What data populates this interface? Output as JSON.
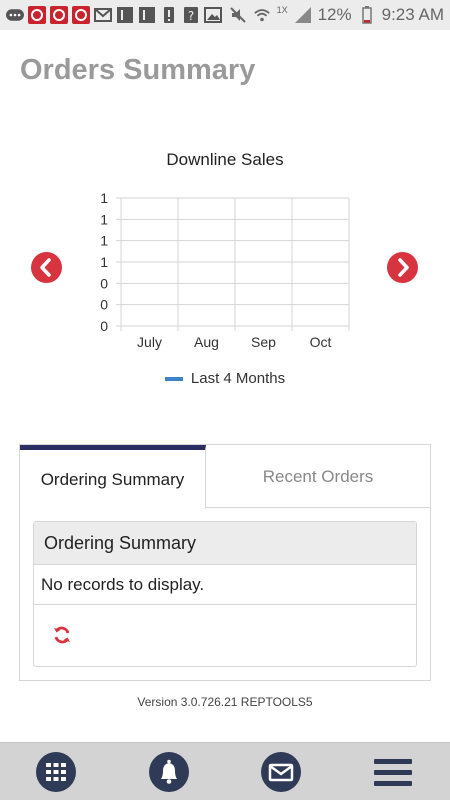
{
  "status_bar": {
    "battery": "12%",
    "time": "9:23 AM",
    "signal_label": "1X",
    "icons": [
      "more-icon",
      "app-notification-icon",
      "app-notification-icon",
      "app-notification-icon",
      "mail-icon",
      "image-icon",
      "image-icon",
      "alert-icon",
      "help-icon",
      "gallery-icon",
      "mute-icon",
      "wifi-icon",
      "signal-icon",
      "battery-icon"
    ]
  },
  "page": {
    "title": "Orders Summary"
  },
  "chart_data": {
    "type": "line",
    "title": "Downline Sales",
    "categories": [
      "July",
      "Aug",
      "Sep",
      "Oct"
    ],
    "y_tick_labels": [
      "1",
      "1",
      "1",
      "1",
      "0",
      "0",
      "0"
    ],
    "series": [
      {
        "name": "Last 4 Months",
        "values": [
          0,
          0,
          0,
          0
        ],
        "color": "#3d85c6"
      }
    ],
    "grid": true,
    "legend": "bottom"
  },
  "chart_nav": {
    "prev_icon": "chevron-left-icon",
    "next_icon": "chevron-right-icon",
    "color": "#d8343f"
  },
  "tabs": [
    {
      "label": "Ordering Summary",
      "active": true
    },
    {
      "label": "Recent Orders",
      "active": false
    }
  ],
  "summary_panel": {
    "header": "Ordering Summary",
    "empty_message": "No records to display.",
    "refresh_icon": "refresh-icon",
    "refresh_color": "#d8343f"
  },
  "footer": {
    "version": "Version 3.0.726.21 REPTOOLS5"
  },
  "bottom_nav": [
    {
      "icon": "grid-icon"
    },
    {
      "icon": "bell-icon"
    },
    {
      "icon": "mail-icon"
    },
    {
      "icon": "menu-icon"
    }
  ],
  "colors": {
    "accent": "#d8343f",
    "tab_indicator": "#2b2d63",
    "nav_icon": "#2f3a57"
  }
}
